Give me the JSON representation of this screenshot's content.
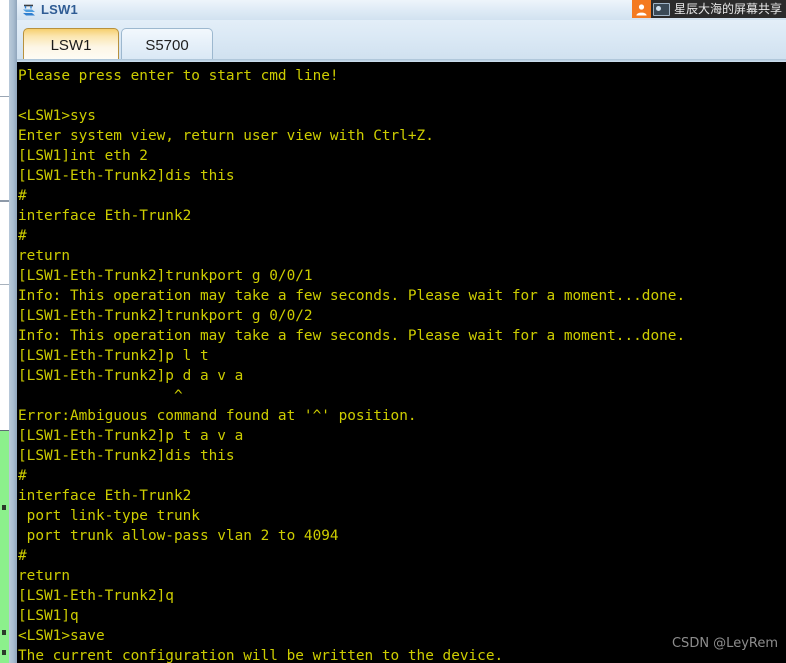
{
  "window": {
    "title": "LSW1",
    "icon": "switch-icon"
  },
  "share_overlay": {
    "avatar_icon": "user-avatar-icon",
    "camera_icon": "screen-share-icon",
    "label": "星辰大海的屏幕共享"
  },
  "tabs": [
    {
      "label": "LSW1",
      "active": true
    },
    {
      "label": "S5700",
      "active": false
    }
  ],
  "terminal": {
    "foreground": "#cdcd00",
    "background": "#000000",
    "lines": [
      "Please press enter to start cmd line!",
      "",
      "<LSW1>sys",
      "Enter system view, return user view with Ctrl+Z.",
      "[LSW1]int eth 2",
      "[LSW1-Eth-Trunk2]dis this",
      "#",
      "interface Eth-Trunk2",
      "#",
      "return",
      "[LSW1-Eth-Trunk2]trunkport g 0/0/1",
      "Info: This operation may take a few seconds. Please wait for a moment...done.",
      "[LSW1-Eth-Trunk2]trunkport g 0/0/2",
      "Info: This operation may take a few seconds. Please wait for a moment...done.",
      "[LSW1-Eth-Trunk2]p l t",
      "[LSW1-Eth-Trunk2]p d a v a",
      "                  ^",
      "Error:Ambiguous command found at '^' position.",
      "[LSW1-Eth-Trunk2]p t a v a",
      "[LSW1-Eth-Trunk2]dis this",
      "#",
      "interface Eth-Trunk2",
      " port link-type trunk",
      " port trunk allow-pass vlan 2 to 4094",
      "#",
      "return",
      "[LSW1-Eth-Trunk2]q",
      "[LSW1]q",
      "<LSW1>save",
      "The current configuration will be written to the device."
    ]
  },
  "watermark": {
    "text": "CSDN @LeyRem"
  }
}
